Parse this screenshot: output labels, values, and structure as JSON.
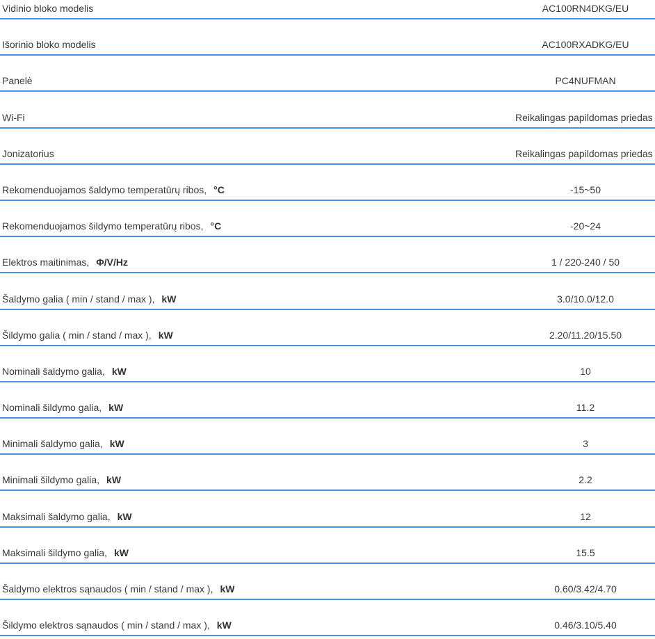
{
  "rows": [
    {
      "label": "Vidinio bloko modelis",
      "unit": "",
      "value": "AC100RN4DKG/EU"
    },
    {
      "label": "Išorinio bloko modelis",
      "unit": "",
      "value": "AC100RXADKG/EU"
    },
    {
      "label": "Panelė",
      "unit": "",
      "value": "PC4NUFMAN"
    },
    {
      "label": "Wi-Fi",
      "unit": "",
      "value": "Reikalingas papildomas priedas"
    },
    {
      "label": "Jonizatorius",
      "unit": "",
      "value": "Reikalingas papildomas priedas"
    },
    {
      "label": "Rekomenduojamos šaldymo temperatūrų ribos,",
      "unit": "°C",
      "value": "-15~50"
    },
    {
      "label": "Rekomenduojamos šildymo temperatūrų ribos,",
      "unit": "°C",
      "value": "-20~24"
    },
    {
      "label": "Elektros maitinimas,",
      "unit": "Φ/V/Hz",
      "value": "1 / 220-240 / 50"
    },
    {
      "label": "Šaldymo galia ( min / stand / max ),",
      "unit": "kW",
      "value": "3.0/10.0/12.0"
    },
    {
      "label": "Šildymo galia ( min / stand / max ),",
      "unit": "kW",
      "value": "2.20/11.20/15.50"
    },
    {
      "label": "Nominali šaldymo galia,",
      "unit": "kW",
      "value": "10"
    },
    {
      "label": "Nominali šildymo galia,",
      "unit": "kW",
      "value": "11.2"
    },
    {
      "label": "Minimali šaldymo galia,",
      "unit": "kW",
      "value": "3"
    },
    {
      "label": "Minimali šildymo galia,",
      "unit": "kW",
      "value": "2.2"
    },
    {
      "label": "Maksimali šaldymo galia,",
      "unit": "kW",
      "value": "12"
    },
    {
      "label": "Maksimali šildymo galia,",
      "unit": "kW",
      "value": "15.5"
    },
    {
      "label": "Šaldymo elektros sąnaudos ( min / stand / max ),",
      "unit": "kW",
      "value": "0.60/3.42/4.70"
    },
    {
      "label": "Šildymo elektros sąnaudos ( min / stand / max ),",
      "unit": "kW",
      "value": "0.46/3.10/5.40"
    }
  ]
}
